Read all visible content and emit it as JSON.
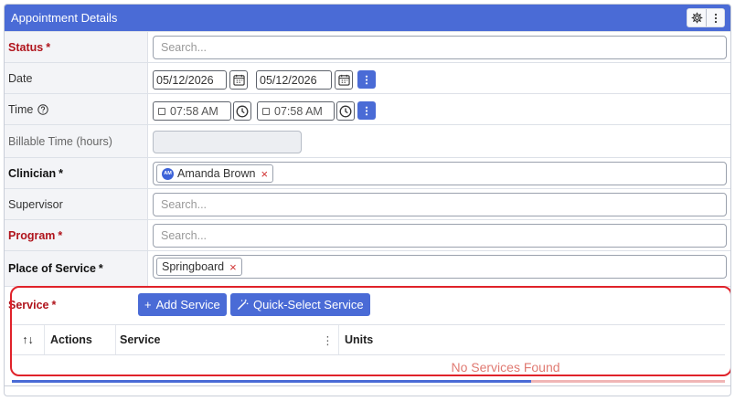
{
  "header": {
    "title": "Appointment Details",
    "settings_icon": "gear-icon",
    "menu_icon": "kebab-icon"
  },
  "status": {
    "label": "Status",
    "required_mark": "*",
    "placeholder": "Search..."
  },
  "date": {
    "label": "Date",
    "start": "05/12/2026",
    "end": "05/12/2026"
  },
  "time": {
    "label": "Time",
    "help_icon": "question-circle-icon",
    "start": "07:58 AM",
    "end": "07:58 AM"
  },
  "billable": {
    "label": "Billable Time (hours)",
    "value": ""
  },
  "clinician": {
    "label": "Clinician",
    "required_mark": "*",
    "avatar_initials": "AM",
    "selected": "Amanda Brown",
    "remove": "×"
  },
  "supervisor": {
    "label": "Supervisor",
    "placeholder": "Search..."
  },
  "program": {
    "label": "Program",
    "required_mark": "*",
    "placeholder": "Search..."
  },
  "place_of_service": {
    "label": "Place of Service",
    "required_mark": "*",
    "selected": "Springboard",
    "remove": "×"
  },
  "service": {
    "label": "Service",
    "required_mark": "*",
    "add_button": "Add Service",
    "quick_button": "Quick-Select Service",
    "columns": {
      "sort": "↑↓",
      "actions": "Actions",
      "service": "Service",
      "menu": "⋮",
      "units": "Units"
    },
    "empty_message": "No Services Found"
  },
  "colors": {
    "accent": "#4a6bd6",
    "required": "#b0141c",
    "highlight": "#e0222a",
    "empty": "#e07a72"
  }
}
